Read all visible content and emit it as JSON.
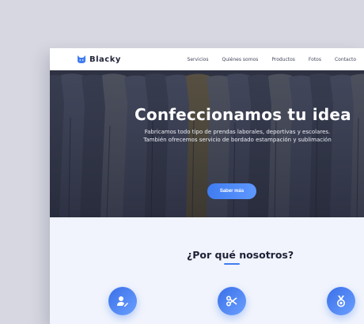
{
  "brand": {
    "name": "Blacky",
    "logo_icon": "cat-head-icon",
    "accent": "#3f7cf0"
  },
  "nav": {
    "items": [
      {
        "label": "Servicios"
      },
      {
        "label": "Quiénes somos"
      },
      {
        "label": "Productos"
      },
      {
        "label": "Fotos"
      },
      {
        "label": "Contacto"
      }
    ]
  },
  "hero": {
    "title": "Confeccionamos tu idea",
    "subtitle_line1": "Fabricamos todo tipo de prendas laborales, deportivas y escolares.",
    "subtitle_line2": "También ofrecemos servicio de bordado estampación y sublimación",
    "cta_label": "Saber más",
    "background": "hanging-shirts-photo"
  },
  "why": {
    "title": "¿Por qué nosotros?",
    "features": [
      {
        "icon": "user-edit-icon"
      },
      {
        "icon": "scissors-icon"
      },
      {
        "icon": "medal-icon"
      }
    ]
  },
  "colors": {
    "page_bg": "#d6d7e0",
    "section_bg": "#f1f4fc",
    "button": "#3f7cf0"
  }
}
